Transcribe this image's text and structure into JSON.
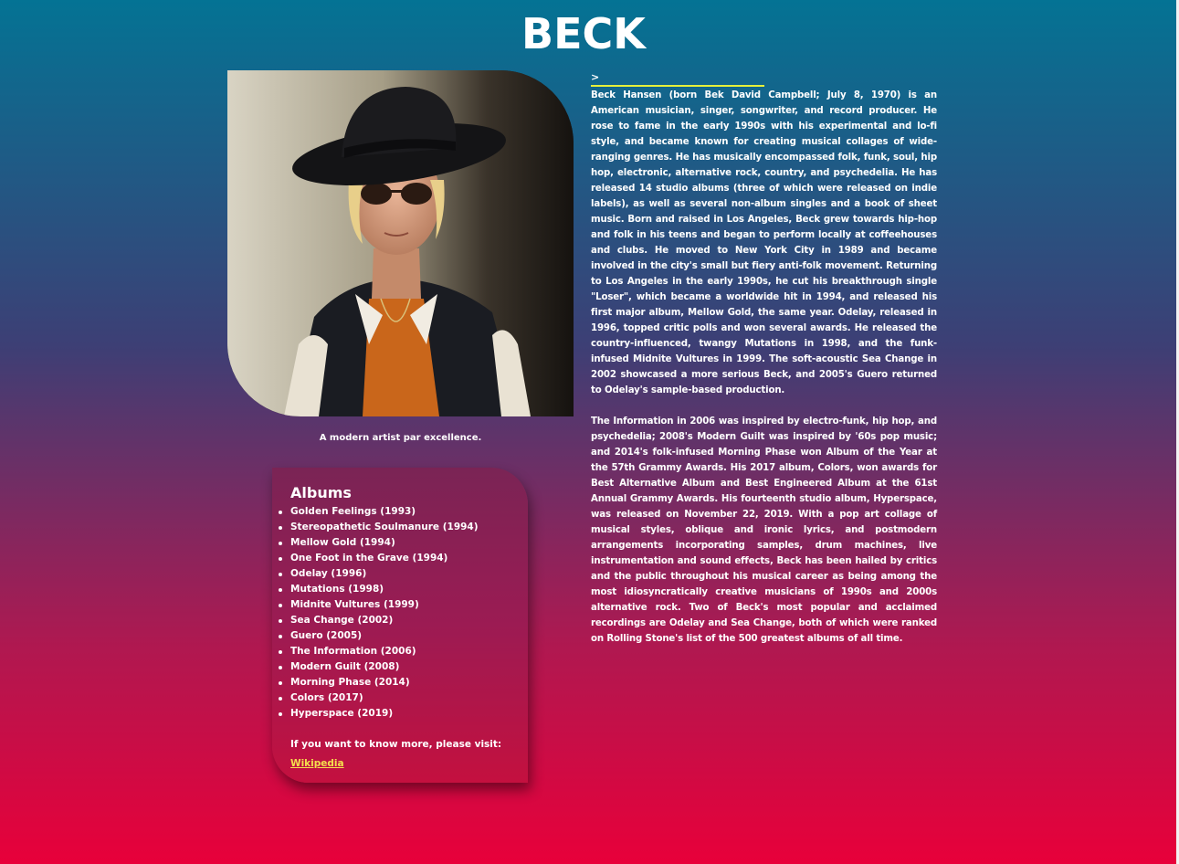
{
  "page": {
    "title": "BECK"
  },
  "photo": {
    "caption": "A modern artist par excellence."
  },
  "bio": {
    "marker": ">",
    "paragraphs": [
      "Beck Hansen (born Bek David Campbell; July 8, 1970) is an American musician, singer, songwriter, and record producer. He rose to fame in the early 1990s with his experimental and lo-fi style, and became known for creating musical collages of wide-ranging genres. He has musically encompassed folk, funk, soul, hip hop, electronic, alternative rock, country, and psychedelia. He has released 14 studio albums (three of which were released on indie labels), as well as several non-album singles and a book of sheet music. Born and raised in Los Angeles, Beck grew towards hip-hop and folk in his teens and began to perform locally at coffeehouses and clubs. He moved to New York City in 1989 and became involved in the city's small but fiery anti-folk movement. Returning to Los Angeles in the early 1990s, he cut his breakthrough single \"Loser\", which became a worldwide hit in 1994, and released his first major album, Mellow Gold, the same year. Odelay, released in 1996, topped critic polls and won several awards. He released the country-influenced, twangy Mutations in 1998, and the funk-infused Midnite Vultures in 1999. The soft-acoustic Sea Change in 2002 showcased a more serious Beck, and 2005's Guero returned to Odelay's sample-based production.",
      "The Information in 2006 was inspired by electro-funk, hip hop, and psychedelia; 2008's Modern Guilt was inspired by '60s pop music; and 2014's folk-infused Morning Phase won Album of the Year at the 57th Grammy Awards. His 2017 album, Colors, won awards for Best Alternative Album and Best Engineered Album at the 61st Annual Grammy Awards. His fourteenth studio album, Hyperspace, was released on November 22, 2019. With a pop art collage of musical styles, oblique and ironic lyrics, and postmodern arrangements incorporating samples, drum machines, live instrumentation and sound effects, Beck has been hailed by critics and the public throughout his musical career as being among the most idiosyncratically creative musicians of 1990s and 2000s alternative rock. Two of Beck's most popular and acclaimed recordings are Odelay and Sea Change, both of which were ranked on Rolling Stone's list of the 500 greatest albums of all time."
    ]
  },
  "albums": {
    "heading": "Albums",
    "items": [
      "Golden Feelings (1993)",
      "Stereopathetic Soulmanure (1994)",
      "Mellow Gold (1994)",
      "One Foot in the Grave (1994)",
      "Odelay (1996)",
      "Mutations (1998)",
      "Midnite Vultures (1999)",
      "Sea Change (2002)",
      "Guero (2005)",
      "The Information (2006)",
      "Modern Guilt (2008)",
      "Morning Phase (2014)",
      "Colors (2017)",
      "Hyperspace (2019)"
    ],
    "more_text": "If you want to know more, please visit:",
    "link_label": "Wikipedia"
  },
  "colors": {
    "gradient_top": "#047394",
    "gradient_bottom": "#e8003a",
    "link": "#f4e04d",
    "marker_underline": "#e6f03a"
  }
}
